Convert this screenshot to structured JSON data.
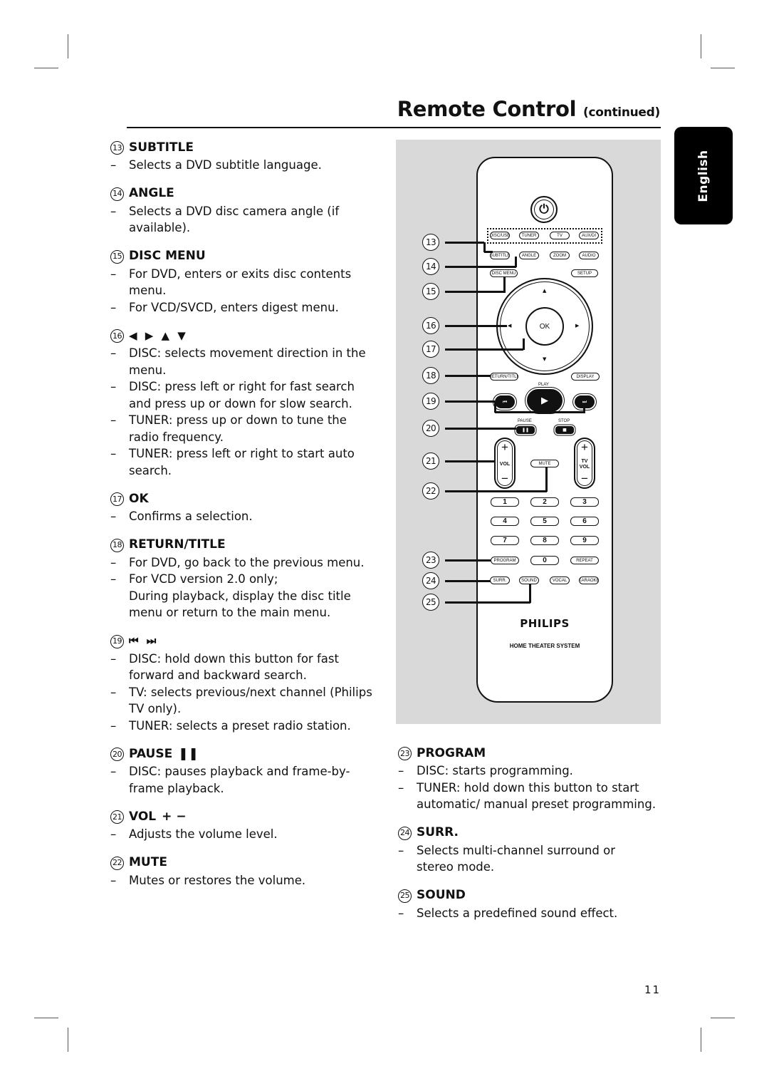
{
  "header": {
    "title": "Remote Control",
    "title_suffix": "(continued)"
  },
  "language_tab": "English",
  "left_sections": [
    {
      "num": "13",
      "title": "SUBTITLE",
      "symbols": "",
      "items": [
        {
          "lines": [
            "Selects a DVD subtitle language."
          ]
        }
      ]
    },
    {
      "num": "14",
      "title": "ANGLE",
      "symbols": "",
      "items": [
        {
          "lines": [
            "Selects a DVD disc camera angle (if",
            "available)."
          ]
        }
      ]
    },
    {
      "num": "15",
      "title": "DISC MENU",
      "symbols": "",
      "items": [
        {
          "lines": [
            "For DVD, enters or exits disc contents",
            "menu."
          ]
        },
        {
          "lines": [
            "For VCD/SVCD, enters digest menu."
          ]
        }
      ]
    },
    {
      "num": "16",
      "title": "",
      "symbols": "◀ ▶ ▲ ▼",
      "items": [
        {
          "lines": [
            "DISC: selects movement direction in the",
            "menu."
          ]
        },
        {
          "lines": [
            "DISC: press left or right for fast search",
            "and press up or down for slow search."
          ]
        },
        {
          "lines": [
            "TUNER: press up or down to tune the",
            "radio frequency."
          ]
        },
        {
          "lines": [
            "TUNER: press left or right to start auto",
            "search."
          ]
        }
      ]
    },
    {
      "num": "17",
      "title": "OK",
      "symbols": "",
      "items": [
        {
          "lines": [
            "Confirms a selection."
          ]
        }
      ]
    },
    {
      "num": "18",
      "title": "RETURN/TITLE",
      "symbols": "",
      "items": [
        {
          "lines": [
            "For DVD, go back to the previous menu."
          ]
        },
        {
          "lines": [
            "For VCD version 2.0 only;",
            "During playback, display the disc title",
            "menu or return to the main menu."
          ]
        }
      ]
    },
    {
      "num": "19",
      "title": "",
      "symbols": "⏮ ⏭",
      "items": [
        {
          "lines": [
            "DISC: hold down this button for fast",
            "forward and backward search."
          ]
        },
        {
          "lines": [
            "TV: selects previous/next channel (Philips",
            "TV only)."
          ]
        },
        {
          "lines": [
            "TUNER: selects a preset radio station."
          ]
        }
      ]
    },
    {
      "num": "20",
      "title": "PAUSE",
      "symbols": "❚❚",
      "items": [
        {
          "lines": [
            "DISC: pauses playback and frame-by-",
            "frame playback."
          ]
        }
      ]
    },
    {
      "num": "21",
      "title": "VOL",
      "symbols": "+ −",
      "items": [
        {
          "lines": [
            "Adjusts the volume level."
          ]
        }
      ]
    },
    {
      "num": "22",
      "title": "MUTE",
      "symbols": "",
      "items": [
        {
          "lines": [
            "Mutes or restores the volume."
          ]
        }
      ]
    }
  ],
  "right_sections": [
    {
      "num": "23",
      "title": "PROGRAM",
      "symbols": "",
      "items": [
        {
          "lines": [
            "DISC: starts programming."
          ]
        },
        {
          "lines": [
            "TUNER: hold down this button to start",
            "automatic/ manual preset programming."
          ]
        }
      ]
    },
    {
      "num": "24",
      "title": "SURR.",
      "symbols": "",
      "items": [
        {
          "lines": [
            "Selects multi-channel surround or",
            "stereo mode."
          ]
        }
      ]
    },
    {
      "num": "25",
      "title": "SOUND",
      "symbols": "",
      "items": [
        {
          "lines": [
            "Selects a predefined sound effect."
          ]
        }
      ]
    }
  ],
  "remote": {
    "callouts": [
      "13",
      "14",
      "15",
      "16",
      "17",
      "18",
      "19",
      "20",
      "21",
      "22",
      "23",
      "24",
      "25"
    ],
    "power_icon": "⏻",
    "source_buttons": [
      "DISC/USB",
      "TUNER",
      "TV",
      "AUX/DI"
    ],
    "row2_buttons": [
      "SUBTITLE",
      "ANGLE",
      "ZOOM",
      "AUDIO"
    ],
    "disc_menu": "DISC MENU",
    "setup": "SETUP",
    "ok": "OK",
    "return_title": "RETURN/TITLE",
    "display": "DISPLAY",
    "play_label": "PLAY",
    "pause_label": "PAUSE",
    "stop_label": "STOP",
    "vol_label": "VOL",
    "tv_vol_label_1": "TV",
    "tv_vol_label_2": "VOL",
    "mute": "MUTE",
    "digits": [
      "1",
      "2",
      "3",
      "4",
      "5",
      "6",
      "7",
      "8",
      "9"
    ],
    "program": "PROGRAM",
    "zero": "0",
    "repeat": "REPEAT",
    "bottom_buttons": [
      "SURR.",
      "SOUND",
      "VOCAL",
      "KARAOKE"
    ],
    "brand": "PHILIPS",
    "brand_sub": "HOME THEATER SYSTEM"
  },
  "page_number": "11"
}
